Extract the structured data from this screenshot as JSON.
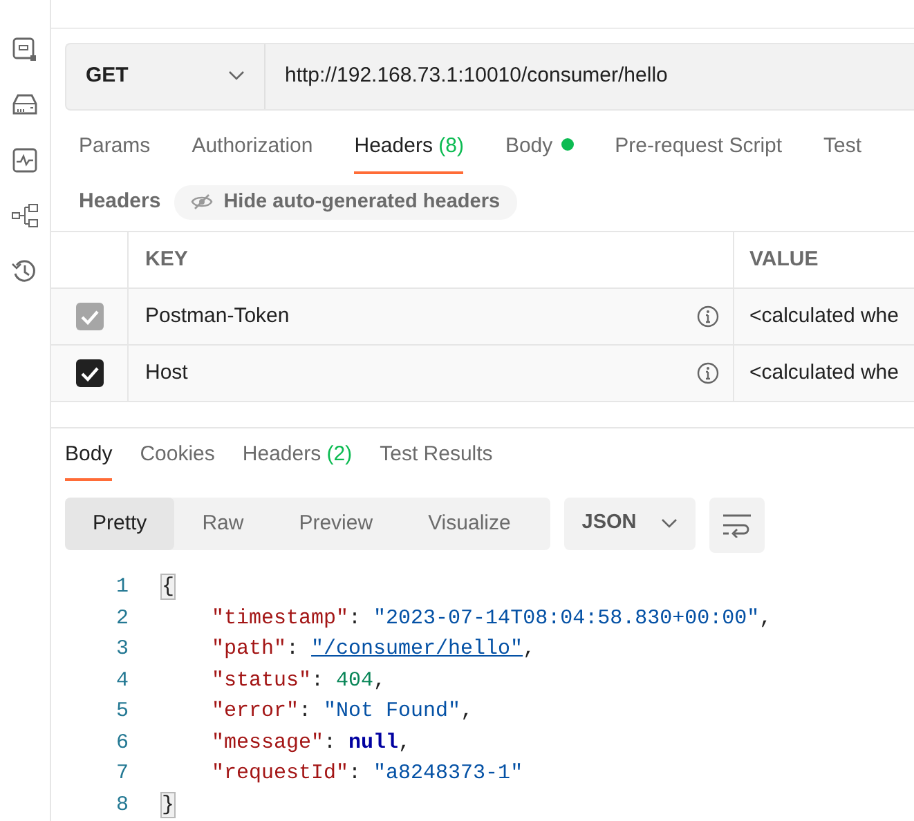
{
  "request": {
    "method": "GET",
    "url": "http://192.168.73.1:10010/consumer/hello"
  },
  "request_tabs": [
    {
      "label": "Params",
      "selected": false
    },
    {
      "label": "Authorization",
      "selected": false
    },
    {
      "label": "Headers",
      "count": "(8)",
      "selected": true
    },
    {
      "label": "Body",
      "dot": true,
      "selected": false
    },
    {
      "label": "Pre-request Script",
      "selected": false
    },
    {
      "label": "Test",
      "selected": false
    }
  ],
  "headers_bar": {
    "label": "Headers",
    "toggle": "Hide auto-generated headers"
  },
  "headers_table": {
    "columns": [
      "KEY",
      "VALUE"
    ],
    "rows": [
      {
        "key": "Postman-Token",
        "value": "<calculated whe",
        "checked": true,
        "disabled": true
      },
      {
        "key": "Host",
        "value": "<calculated whe",
        "checked": true,
        "disabled": false
      }
    ]
  },
  "response_tabs": [
    {
      "label": "Body",
      "selected": true
    },
    {
      "label": "Cookies",
      "selected": false
    },
    {
      "label": "Headers",
      "count": "(2)",
      "selected": false
    },
    {
      "label": "Test Results",
      "selected": false
    }
  ],
  "view_modes": [
    {
      "label": "Pretty",
      "selected": true
    },
    {
      "label": "Raw",
      "selected": false
    },
    {
      "label": "Preview",
      "selected": false
    },
    {
      "label": "Visualize",
      "selected": false
    }
  ],
  "format": "JSON",
  "code_lines": [
    {
      "number": "1",
      "indent": false,
      "tokens": [
        {
          "kind": "bracket",
          "text": "{"
        }
      ]
    },
    {
      "number": "2",
      "indent": true,
      "tokens": [
        {
          "kind": "key",
          "text": "\"timestamp\""
        },
        {
          "kind": "punct",
          "text": ": "
        },
        {
          "kind": "string",
          "text": "\"2023-07-14T08:04:58.830+00:00\""
        },
        {
          "kind": "punct",
          "text": ","
        }
      ]
    },
    {
      "number": "3",
      "indent": true,
      "tokens": [
        {
          "kind": "key",
          "text": "\"path\""
        },
        {
          "kind": "punct",
          "text": ": "
        },
        {
          "kind": "link",
          "text": "\"/consumer/hello\""
        },
        {
          "kind": "punct",
          "text": ","
        }
      ]
    },
    {
      "number": "4",
      "indent": true,
      "tokens": [
        {
          "kind": "key",
          "text": "\"status\""
        },
        {
          "kind": "punct",
          "text": ": "
        },
        {
          "kind": "number",
          "text": "404"
        },
        {
          "kind": "punct",
          "text": ","
        }
      ]
    },
    {
      "number": "5",
      "indent": true,
      "tokens": [
        {
          "kind": "key",
          "text": "\"error\""
        },
        {
          "kind": "punct",
          "text": ": "
        },
        {
          "kind": "string",
          "text": "\"Not Found\""
        },
        {
          "kind": "punct",
          "text": ","
        }
      ]
    },
    {
      "number": "6",
      "indent": true,
      "tokens": [
        {
          "kind": "key",
          "text": "\"message\""
        },
        {
          "kind": "punct",
          "text": ": "
        },
        {
          "kind": "null",
          "text": "null"
        },
        {
          "kind": "punct",
          "text": ","
        }
      ]
    },
    {
      "number": "7",
      "indent": true,
      "tokens": [
        {
          "kind": "key",
          "text": "\"requestId\""
        },
        {
          "kind": "punct",
          "text": ": "
        },
        {
          "kind": "string",
          "text": "\"a8248373-1\""
        }
      ]
    },
    {
      "number": "8",
      "indent": false,
      "tokens": [
        {
          "kind": "bracket",
          "text": "}"
        }
      ]
    }
  ]
}
